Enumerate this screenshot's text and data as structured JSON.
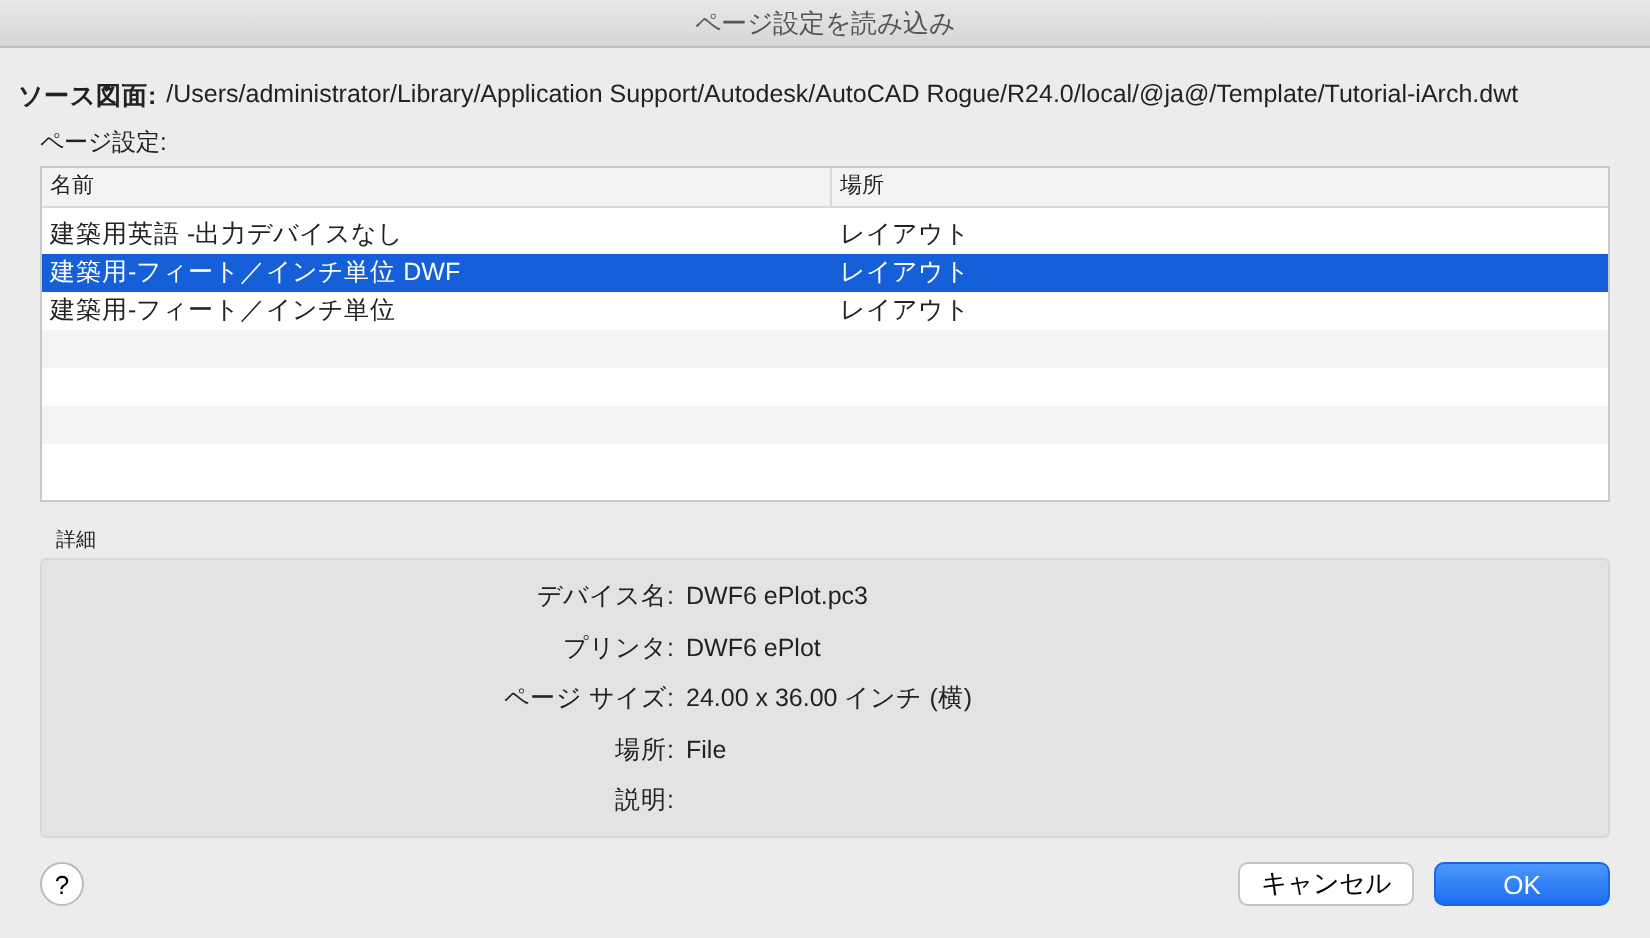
{
  "window": {
    "title": "ページ設定を読み込み"
  },
  "source": {
    "label": "ソース図面:",
    "path": "/Users/administrator/Library/Application Support/Autodesk/AutoCAD Rogue/R24.0/local/@ja@/Template/Tutorial-iArch.dwt"
  },
  "page_setups": {
    "label": "ページ設定:",
    "columns": [
      "名前",
      "場所"
    ],
    "rows": [
      {
        "name": "建築用英語 -出力デバイスなし",
        "location": "レイアウト",
        "selected": false
      },
      {
        "name": "建築用-フィート／インチ単位 DWF",
        "location": "レイアウト",
        "selected": true
      },
      {
        "name": "建築用-フィート／インチ単位",
        "location": "レイアウト",
        "selected": false
      }
    ]
  },
  "details": {
    "label": "詳細",
    "fields": [
      {
        "label": "デバイス名:",
        "value": "DWF6 ePlot.pc3"
      },
      {
        "label": "プリンタ:",
        "value": "DWF6 ePlot"
      },
      {
        "label": "ページ サイズ:",
        "value": "24.00 x 36.00 インチ (横)"
      },
      {
        "label": "場所:",
        "value": "File"
      },
      {
        "label": "説明:"
      }
    ]
  },
  "help_button": "?",
  "buttons": [
    {
      "label": "キャンセル",
      "kind": "secondary"
    },
    {
      "label": "OK",
      "kind": "primary"
    }
  ]
}
